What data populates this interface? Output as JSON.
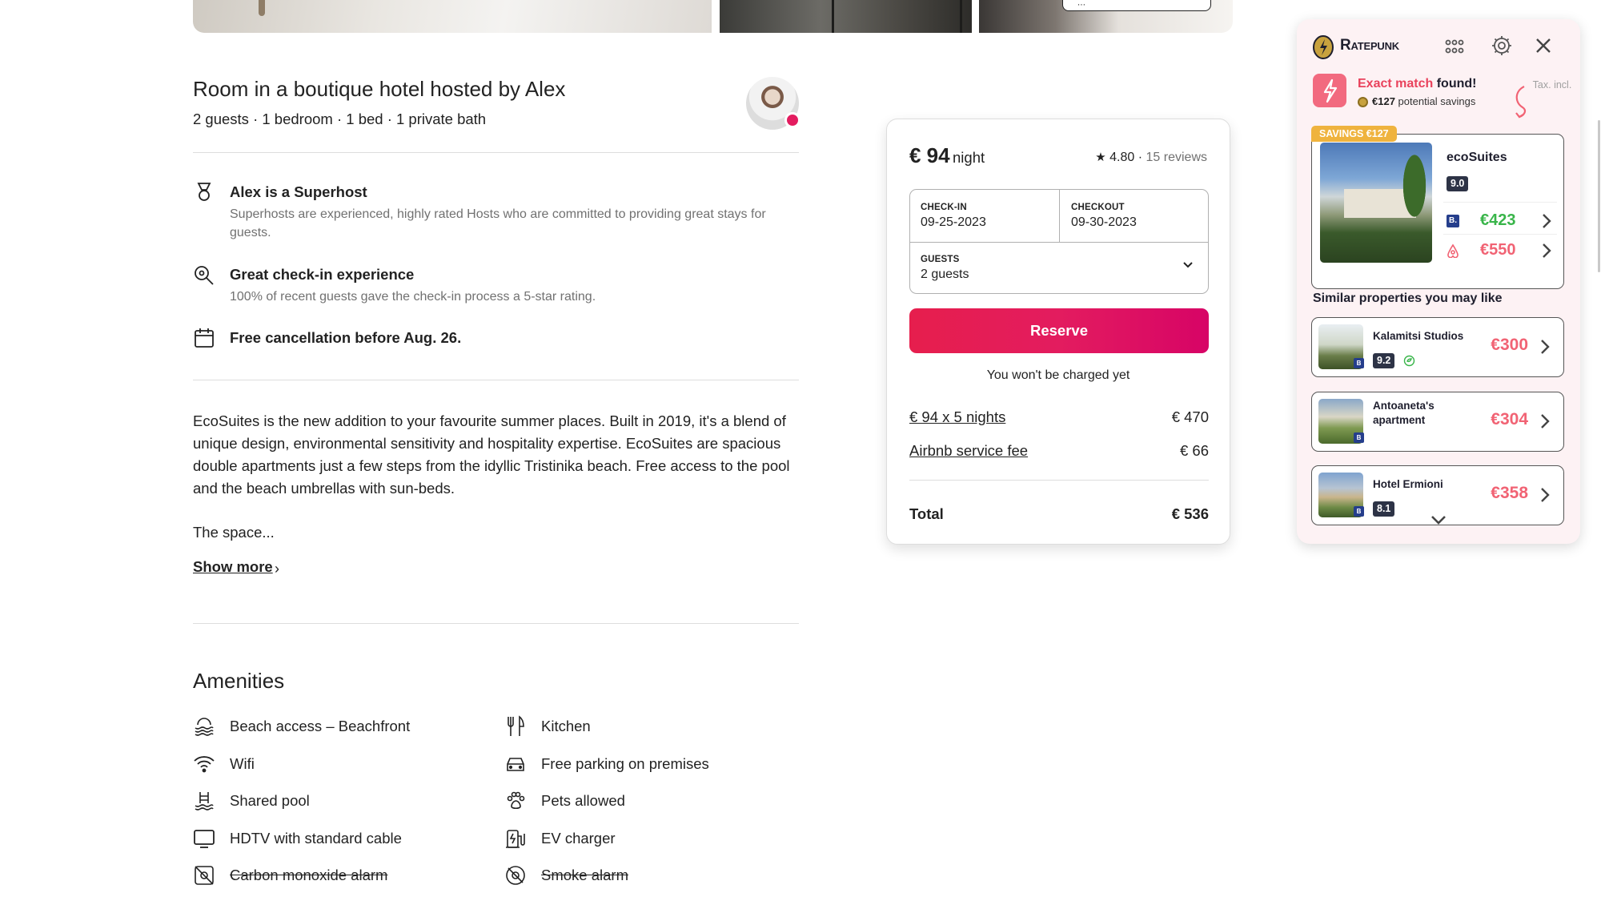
{
  "listing": {
    "title": "Room in a boutique hotel hosted by Alex",
    "overview": "2 guests · 1 bedroom · 1 bed · 1 private bath"
  },
  "highlights": [
    {
      "icon": "superhost-medal-icon",
      "title": "Alex is a Superhost",
      "desc": "Superhosts are experienced, highly rated Hosts who are committed to providing great stays for guests."
    },
    {
      "icon": "checkin-search-icon",
      "title": "Great check-in experience",
      "desc": "100% of recent guests gave the check-in process a 5-star rating."
    },
    {
      "icon": "calendar-icon",
      "title": "Free cancellation before Aug. 26.",
      "desc": ""
    }
  ],
  "description": {
    "text": "EcoSuites is the new addition to your favourite summer places. Built in 2019, it's a blend of unique design, environmental sensitivity and hospitality expertise. EcoSuites are spacious double apartments just a few steps from the idyllic Tristinika beach. Free access to the pool and the beach umbrellas with sun-beds.",
    "space_label": "The space...",
    "show_more": "Show more"
  },
  "amenities": {
    "title": "Amenities",
    "left": [
      {
        "label": "Beach access – Beachfront",
        "icon": "beach-icon",
        "unavailable": false
      },
      {
        "label": "Wifi",
        "icon": "wifi-icon",
        "unavailable": false
      },
      {
        "label": "Shared pool",
        "icon": "pool-icon",
        "unavailable": false
      },
      {
        "label": "HDTV with standard cable",
        "icon": "tv-icon",
        "unavailable": false
      },
      {
        "label": "Carbon monoxide alarm",
        "icon": "carbon-monoxide-alarm-icon",
        "unavailable": true
      }
    ],
    "right": [
      {
        "label": "Kitchen",
        "icon": "kitchen-icon",
        "unavailable": false
      },
      {
        "label": "Free parking on premises",
        "icon": "car-icon",
        "unavailable": false
      },
      {
        "label": "Pets allowed",
        "icon": "paw-icon",
        "unavailable": false
      },
      {
        "label": "EV charger",
        "icon": "ev-charger-icon",
        "unavailable": false
      },
      {
        "label": "Smoke alarm",
        "icon": "smoke-alarm-icon",
        "unavailable": true
      }
    ]
  },
  "booking": {
    "price": "€ 94",
    "price_unit": "night",
    "rating": "4.80",
    "rating_sep": "·",
    "reviews": "15 reviews",
    "checkin_label": "CHECK-IN",
    "checkin_value": "09-25-2023",
    "checkout_label": "CHECKOUT",
    "checkout_value": "09-30-2023",
    "guests_label": "GUESTS",
    "guests_value": "2 guests",
    "reserve": "Reserve",
    "not_charged": "You won't be charged yet",
    "nights_label": "€ 94 x 5 nights",
    "nights_amount": "€ 470",
    "fee_label": "Airbnb service fee",
    "fee_amount": "€ 66",
    "total_label": "Total",
    "total_amount": "€ 536"
  },
  "ratepunk": {
    "brand": "Ratepunk",
    "match_title": "Exact match",
    "match_title_suffix": "found!",
    "savings_amount": "€127",
    "savings_text": "potential savings",
    "tax_note": "Tax. incl.",
    "savings_tag": "SAVINGS €127",
    "main": {
      "name": "ecoSuites",
      "score": "9.0",
      "booking_price": "€423",
      "airbnb_price": "€550"
    },
    "similar_title": "Similar properties you may like",
    "similar": [
      {
        "name": "Kalamitsi Studios",
        "score": "9.2",
        "price": "€300"
      },
      {
        "name": "Antoaneta's apartment",
        "score": "",
        "price": "€304"
      },
      {
        "name": "Hotel Ermioni",
        "score": "8.1",
        "price": "€358"
      }
    ],
    "colors": {
      "accent": "#f16374",
      "green": "#39b54a",
      "gold": "#efb33e",
      "dark": "#1f1f2e"
    }
  },
  "colors": {
    "airbnb_pink": "#e31c5f",
    "text": "#222222",
    "muted": "#717171"
  }
}
